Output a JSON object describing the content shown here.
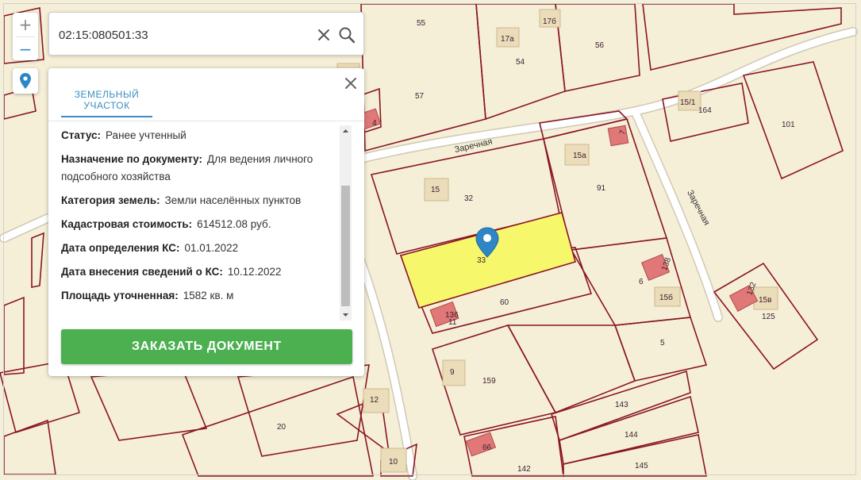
{
  "search": {
    "value": "02:15:080501:33",
    "placeholder": ""
  },
  "zoom": {
    "in_label": "+",
    "out_label": "−"
  },
  "panel": {
    "tab_line1": "ЗЕМЕЛЬНЫЙ",
    "tab_line2": "УЧАСТОК",
    "fields": [
      {
        "key": "Статус:",
        "value": "Ранее учтенный"
      },
      {
        "key": "Назначение по документу:",
        "value": "Для ведения личного подсобного хозяйства"
      },
      {
        "key": "Категория земель:",
        "value": "Земли населённых пунктов"
      },
      {
        "key": "Кадастровая стоимость:",
        "value": "614512.08 руб."
      },
      {
        "key": "Дата определения КС:",
        "value": "01.01.2022"
      },
      {
        "key": "Дата внесения сведений о КС:",
        "value": "10.12.2022"
      },
      {
        "key": "Площадь уточненная:",
        "value": "1582 кв. м"
      }
    ],
    "order_label": "ЗАКАЗАТЬ ДОКУМЕНТ"
  },
  "map": {
    "streets": [
      "Заречная",
      "Заречная"
    ],
    "parcel_labels": [
      "55",
      "56",
      "54",
      "57",
      "164",
      "101",
      "32",
      "91",
      "33",
      "60",
      "6",
      "5",
      "125",
      "159",
      "143",
      "144",
      "145",
      "142",
      "20"
    ],
    "building_labels": [
      "17б",
      "17а",
      "15/1",
      "15а",
      "15",
      "4",
      "7",
      "138",
      "15б",
      "132",
      "15в",
      "136",
      "11",
      "9",
      "12",
      "66",
      "10"
    ],
    "colors": {
      "background": "#f5efd8",
      "parcel_border": "#8a1423",
      "selected_fill": "#f7f76b",
      "building_fill": "#ebdcba",
      "highlight_building": "#e07878",
      "road": "#ffffff",
      "marker": "#2f86c6"
    }
  }
}
